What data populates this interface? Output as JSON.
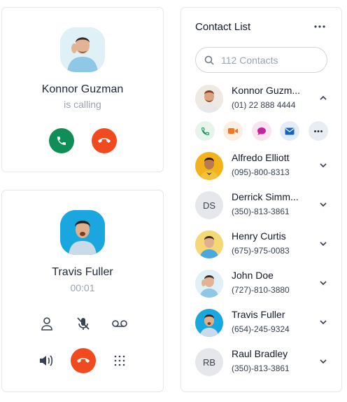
{
  "incoming_call": {
    "name": "Konnor Guzman",
    "status": "is calling"
  },
  "active_call": {
    "name": "Travis Fuller",
    "duration": "00:01"
  },
  "contacts": {
    "title": "Contact List",
    "search_placeholder": "112 Contacts",
    "items": [
      {
        "name": "Konnor Guzm...",
        "phone": "(01) 22 888 4444",
        "initials": "",
        "expanded": true
      },
      {
        "name": "Alfredo Elliott",
        "phone": "(095)-800-8313",
        "initials": ""
      },
      {
        "name": "Derrick Simm...",
        "phone": "(350)-813-3861",
        "initials": "DS"
      },
      {
        "name": "Henry Curtis",
        "phone": "(675)-975-0083",
        "initials": ""
      },
      {
        "name": "John Doe",
        "phone": "(727)-810-3880",
        "initials": ""
      },
      {
        "name": "Travis Fuller",
        "phone": "(654)-245-9324",
        "initials": ""
      },
      {
        "name": "Raul Bradley",
        "phone": "(350)-813-3861",
        "initials": "RB"
      }
    ],
    "quick_actions": [
      "phone-icon",
      "video-icon",
      "chat-icon",
      "mail-icon",
      "more-icon"
    ]
  },
  "colors": {
    "accept": "#0f8f57",
    "decline": "#f04a1e",
    "muted_text": "#9aa3af"
  }
}
